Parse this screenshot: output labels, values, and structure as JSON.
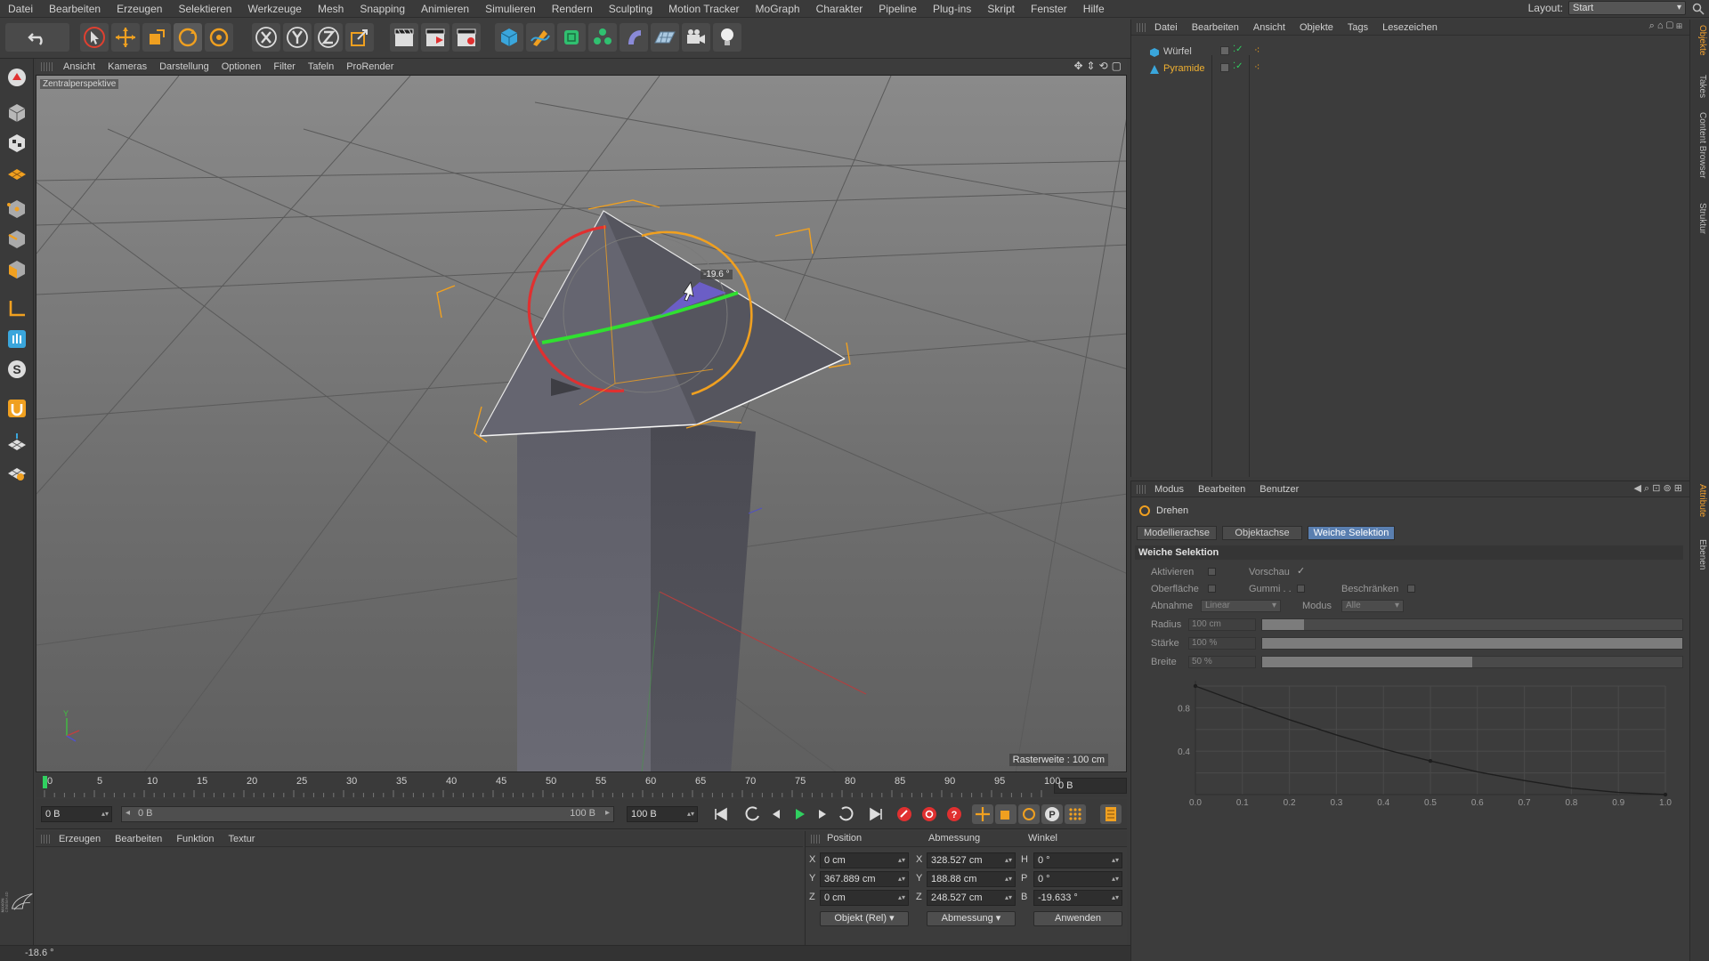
{
  "menu": [
    "Datei",
    "Bearbeiten",
    "Erzeugen",
    "Selektieren",
    "Werkzeuge",
    "Mesh",
    "Snapping",
    "Animieren",
    "Simulieren",
    "Rendern",
    "Sculpting",
    "Motion Tracker",
    "MoGraph",
    "Charakter",
    "Pipeline",
    "Plug-ins",
    "Skript",
    "Fenster",
    "Hilfe"
  ],
  "layout": {
    "label": "Layout:",
    "value": "Start"
  },
  "viewport": {
    "menu": [
      "Ansicht",
      "Kameras",
      "Darstellung",
      "Optionen",
      "Filter",
      "Tafeln",
      "ProRender"
    ],
    "camera_label": "Zentralperspektive",
    "raster_label": "Rasterweite : 100 cm",
    "rotation_readout": "-19.6 °"
  },
  "timeline": {
    "ticks": [
      "0",
      "5",
      "10",
      "15",
      "20",
      "25",
      "30",
      "35",
      "40",
      "45",
      "50",
      "55",
      "60",
      "65",
      "70",
      "75",
      "80",
      "85",
      "90",
      "95",
      "100"
    ],
    "current_frame": "0 B"
  },
  "transport": {
    "start": "0 B",
    "range_left": "0 B",
    "range_right": "100 B",
    "end": "100 B"
  },
  "material_menu": [
    "Erzeugen",
    "Bearbeiten",
    "Funktion",
    "Textur"
  ],
  "coords": {
    "headers": [
      "Position",
      "Abmessung",
      "Winkel"
    ],
    "rows": [
      {
        "axis": "X",
        "pos": "0 cm",
        "size_axis": "X",
        "size": "328.527 cm",
        "rot_axis": "H",
        "rot": "0 °"
      },
      {
        "axis": "Y",
        "pos": "367.889 cm",
        "size_axis": "Y",
        "size": "188.88 cm",
        "rot_axis": "P",
        "rot": "0 °"
      },
      {
        "axis": "Z",
        "pos": "0 cm",
        "size_axis": "Z",
        "size": "248.527 cm",
        "rot_axis": "B",
        "rot": "-19.633 °"
      }
    ],
    "mode": "Objekt (Rel)",
    "size_mode": "Abmessung",
    "apply": "Anwenden"
  },
  "status": "-18.6 °",
  "objects": {
    "menu": [
      "Datei",
      "Bearbeiten",
      "Ansicht",
      "Objekte",
      "Tags",
      "Lesezeichen"
    ],
    "items": [
      {
        "name": "Würfel",
        "color": "#c8c8c8",
        "icon": "cube-icon"
      },
      {
        "name": "Pyramide",
        "color": "#f0b030",
        "icon": "pyramid-icon"
      }
    ]
  },
  "attributes": {
    "menu": [
      "Modus",
      "Bearbeiten",
      "Benutzer"
    ],
    "tool": "Drehen",
    "tabs": [
      "Modellierachse",
      "Objektachse",
      "Weiche Selektion"
    ],
    "active_tab": "Weiche Selektion",
    "section": "Weiche Selektion",
    "labels": {
      "aktivieren": "Aktivieren",
      "vorschau": "Vorschau",
      "vorschau_mark": "✓",
      "oberflaeche": "Oberfläche",
      "gummi": "Gummi . .",
      "beschraenken": "Beschränken",
      "abnahme": "Abnahme",
      "abnahme_value": "Linear",
      "modus": "Modus",
      "modus_value": "Alle",
      "radius": "Radius",
      "radius_value": "100 cm",
      "staerke": "Stärke",
      "staerke_value": "100 %",
      "breite": "Breite",
      "breite_value": "50 %"
    },
    "sliders": {
      "radius": 0.1,
      "staerke": 1.0,
      "breite": 0.5
    }
  },
  "chart_data": {
    "type": "line",
    "title": "",
    "xlabel": "",
    "ylabel": "",
    "x": [
      0.0,
      0.1,
      0.2,
      0.3,
      0.4,
      0.5,
      0.6,
      0.7,
      0.8,
      0.9,
      1.0
    ],
    "series": [
      {
        "values": [
          1.0,
          0.84,
          0.69,
          0.55,
          0.42,
          0.31,
          0.21,
          0.13,
          0.06,
          0.02,
          0.0
        ]
      }
    ],
    "x_ticks": [
      "0.0",
      "0.1",
      "0.2",
      "0.3",
      "0.4",
      "0.5",
      "0.6",
      "0.7",
      "0.8",
      "0.9",
      "1.0"
    ],
    "y_ticks": [
      "0.4",
      "0.8"
    ],
    "xlim": [
      0,
      1
    ],
    "ylim": [
      0,
      1
    ],
    "grid": true
  },
  "side_tabs": [
    "Objekte",
    "Takes",
    "Content Browser",
    "Struktur",
    "Attribute",
    "Ebenen"
  ]
}
